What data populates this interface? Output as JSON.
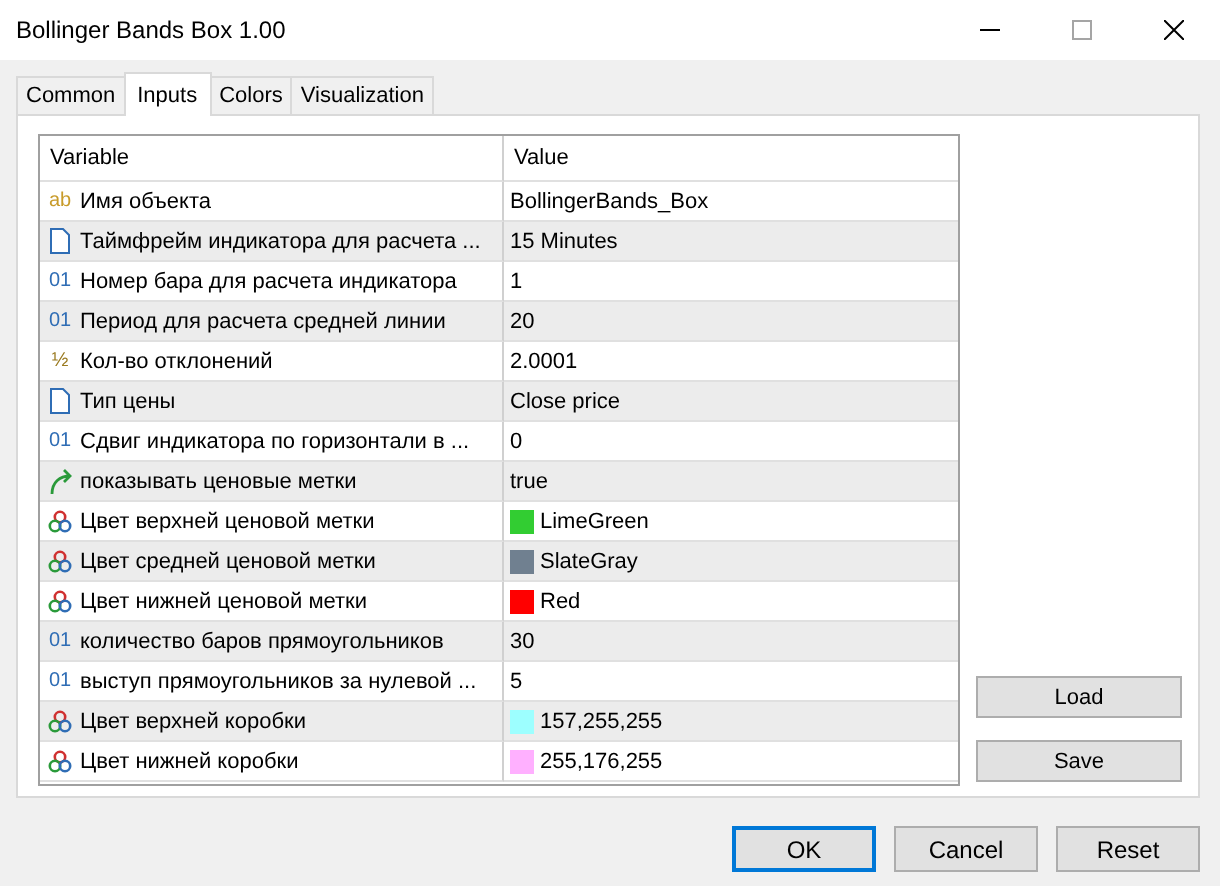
{
  "window": {
    "title": "Bollinger Bands Box 1.00",
    "maximize_disabled": true
  },
  "tabs": [
    {
      "label": "Common",
      "selected": false
    },
    {
      "label": "Inputs",
      "selected": true
    },
    {
      "label": "Colors",
      "selected": false
    },
    {
      "label": "Visualization",
      "selected": false
    }
  ],
  "table": {
    "columns": [
      "Variable",
      "Value"
    ],
    "rows": [
      {
        "kind": "string",
        "type_icon": "ab",
        "variable": "Имя объекта",
        "value": "BollingerBands_Box"
      },
      {
        "kind": "enum",
        "variable": "Таймфрейм индикатора для расчета ...",
        "value": "15 Minutes"
      },
      {
        "kind": "int",
        "type_icon": "01",
        "variable": "Номер бара для расчета индикатора",
        "value": "1"
      },
      {
        "kind": "int",
        "type_icon": "01",
        "variable": "Период для расчета средней линии",
        "value": "20"
      },
      {
        "kind": "double",
        "type_icon": "½",
        "variable": "Кол-во отклонений",
        "value": "2.0001"
      },
      {
        "kind": "enum",
        "variable": "Тип цены",
        "value": "Close price"
      },
      {
        "kind": "int",
        "type_icon": "01",
        "variable": "Сдвиг индикатора по горизонтали в ...",
        "value": "0"
      },
      {
        "kind": "bool",
        "variable": "показывать ценовые метки",
        "value": "true"
      },
      {
        "kind": "color",
        "variable": "Цвет верхней ценовой метки",
        "value": "LimeGreen",
        "color": "#32cd32"
      },
      {
        "kind": "color",
        "variable": "Цвет средней ценовой метки",
        "value": "SlateGray",
        "color": "#708090"
      },
      {
        "kind": "color",
        "variable": "Цвет нижней ценовой метки",
        "value": "Red",
        "color": "#ff0000"
      },
      {
        "kind": "int",
        "type_icon": "01",
        "variable": "количество баров прямоугольников",
        "value": "30"
      },
      {
        "kind": "int",
        "type_icon": "01",
        "variable": "выступ прямоугольников за нулевой ...",
        "value": "5"
      },
      {
        "kind": "color",
        "variable": "Цвет верхней коробки",
        "value": "157,255,255",
        "color": "#9dffff"
      },
      {
        "kind": "color",
        "variable": "Цвет нижней коробки",
        "value": "255,176,255",
        "color": "#ffb0ff"
      }
    ]
  },
  "side_buttons": [
    "Load",
    "Save"
  ],
  "dialog_buttons": [
    {
      "label": "OK",
      "default": true
    },
    {
      "label": "Cancel",
      "default": false
    },
    {
      "label": "Reset",
      "default": false
    }
  ]
}
